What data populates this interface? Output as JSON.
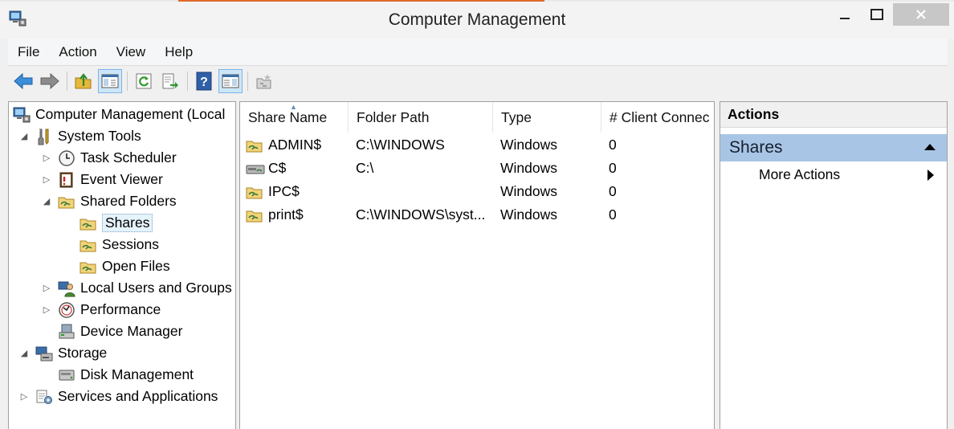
{
  "window": {
    "title": "Computer Management",
    "controls": {
      "minimize": "minimize-icon",
      "maximize": "maximize-icon",
      "close": "close-icon"
    }
  },
  "menu": [
    "File",
    "Action",
    "View",
    "Help"
  ],
  "toolbar": [
    "back",
    "forward",
    "up-one-level",
    "show-hide-console-tree",
    "refresh",
    "export-list",
    "help",
    "show-hide-action-pane",
    "new-share"
  ],
  "tree": {
    "root": "Computer Management (Local",
    "system_tools": "System Tools",
    "task_scheduler": "Task Scheduler",
    "event_viewer": "Event Viewer",
    "shared_folders": "Shared Folders",
    "shares": "Shares",
    "sessions": "Sessions",
    "open_files": "Open Files",
    "local_users": "Local Users and Groups",
    "performance": "Performance",
    "device_manager": "Device Manager",
    "storage": "Storage",
    "disk_management": "Disk Management",
    "services_apps": "Services and Applications"
  },
  "list": {
    "columns": [
      "Share Name",
      "Folder Path",
      "Type",
      "# Client Connec"
    ],
    "rows": [
      {
        "name": "ADMIN$",
        "path": "C:\\WINDOWS",
        "type": "Windows",
        "clients": "0"
      },
      {
        "name": "C$",
        "path": "C:\\",
        "type": "Windows",
        "clients": "0"
      },
      {
        "name": "IPC$",
        "path": "",
        "type": "Windows",
        "clients": "0"
      },
      {
        "name": "print$",
        "path": "C:\\WINDOWS\\syst...",
        "type": "Windows",
        "clients": "0"
      }
    ]
  },
  "actions": {
    "header": "Actions",
    "section": "Shares",
    "more": "More Actions"
  },
  "colors": {
    "selection_bar": "#a9c5e6",
    "tree_selected": "#e5f3fb",
    "toolbar_pressed": "#cde6f7"
  }
}
